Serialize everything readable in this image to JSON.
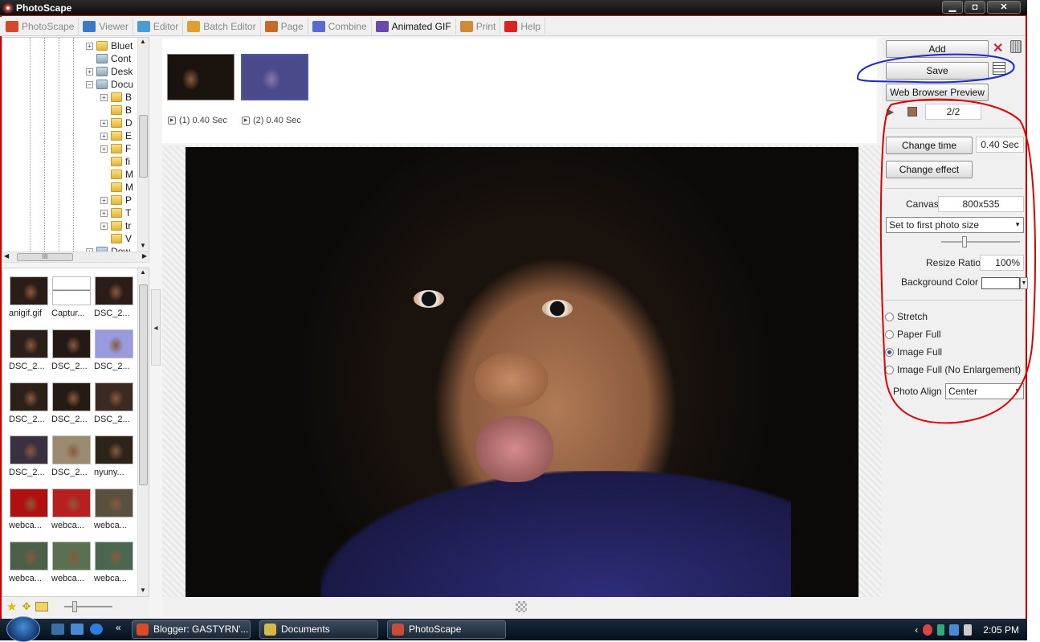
{
  "window": {
    "title": "PhotoScape",
    "minimize": "▁",
    "maximize": "◘",
    "close": "✕"
  },
  "tabs": [
    {
      "label": "PhotoScape",
      "color": "#d24a2a",
      "active": false
    },
    {
      "label": "Viewer",
      "color": "#3a7ac4",
      "active": false
    },
    {
      "label": "Editor",
      "color": "#4a9bd6",
      "active": false
    },
    {
      "label": "Batch Editor",
      "color": "#e0a030",
      "active": false
    },
    {
      "label": "Page",
      "color": "#c66a2a",
      "active": false
    },
    {
      "label": "Combine",
      "color": "#5a6ad0",
      "active": false
    },
    {
      "label": "Animated GIF",
      "color": "#6a4aa8",
      "active": true
    },
    {
      "label": "Print",
      "color": "#d08a3a",
      "active": false
    },
    {
      "label": "Help",
      "color": "#d22",
      "active": false
    }
  ],
  "tree": {
    "items": [
      {
        "label": "Bluet",
        "exp": "+",
        "type": "folder"
      },
      {
        "label": "Cont",
        "exp": "",
        "type": "blue"
      },
      {
        "label": "Desk",
        "exp": "+",
        "type": "blue"
      },
      {
        "label": "Docu",
        "exp": "−",
        "type": "blue"
      },
      {
        "label": "B",
        "exp": "+",
        "type": "folder"
      },
      {
        "label": "B",
        "exp": "",
        "type": "folder"
      },
      {
        "label": "D",
        "exp": "+",
        "type": "folder"
      },
      {
        "label": "E",
        "exp": "+",
        "type": "folder"
      },
      {
        "label": "F",
        "exp": "+",
        "type": "folder"
      },
      {
        "label": "fi",
        "exp": "",
        "type": "folder"
      },
      {
        "label": "M",
        "exp": "",
        "type": "folder"
      },
      {
        "label": "M",
        "exp": "",
        "type": "folder"
      },
      {
        "label": "P",
        "exp": "+",
        "type": "folder"
      },
      {
        "label": "T",
        "exp": "+",
        "type": "folder"
      },
      {
        "label": "tr",
        "exp": "+",
        "type": "folder"
      },
      {
        "label": "V",
        "exp": "",
        "type": "folder"
      },
      {
        "label": "Dow",
        "exp": "+",
        "type": "blue"
      }
    ],
    "hscroll_label": "III"
  },
  "thumbnails": [
    {
      "label": "anigif.gif",
      "tone": "#2a1d18"
    },
    {
      "label": "Captur...",
      "tone": "#f4f4f4"
    },
    {
      "label": "DSC_2...",
      "tone": "#2a1d18"
    },
    {
      "label": "DSC_2...",
      "tone": "#2b1f1a"
    },
    {
      "label": "DSC_2...",
      "tone": "#241914"
    },
    {
      "label": "DSC_2...",
      "tone": "#9a9ae0"
    },
    {
      "label": "DSC_2...",
      "tone": "#2c2018"
    },
    {
      "label": "DSC_2...",
      "tone": "#261a14"
    },
    {
      "label": "DSC_2...",
      "tone": "#3a2a22"
    },
    {
      "label": "DSC_2...",
      "tone": "#3a3040"
    },
    {
      "label": "DSC_2...",
      "tone": "#9a8a70"
    },
    {
      "label": "nyuny...",
      "tone": "#2c2418"
    },
    {
      "label": "webca...",
      "tone": "#b01010"
    },
    {
      "label": "webca...",
      "tone": "#b82020"
    },
    {
      "label": "webca...",
      "tone": "#5a5040"
    },
    {
      "label": "webca...",
      "tone": "#4a6048"
    },
    {
      "label": "webca...",
      "tone": "#5a7050"
    },
    {
      "label": "webca...",
      "tone": "#4a6850"
    }
  ],
  "frames": [
    {
      "label": "(1) 0.40 Sec",
      "selected": false
    },
    {
      "label": "(2) 0.40 Sec",
      "selected": true
    }
  ],
  "right_panel": {
    "add": "Add",
    "save": "Save",
    "web_preview": "Web Browser Preview",
    "frame_counter": "2/2",
    "change_time": "Change time",
    "time_value": "0.40 Sec",
    "change_effect": "Change effect",
    "canvas_label": "Canvas",
    "canvas_value": "800x535",
    "size_mode": "Set to first photo size",
    "resize_ratio_label": "Resize Ratio",
    "resize_ratio_value": "100%",
    "resize_ratio_level": 0.3,
    "bg_color_label": "Background Color",
    "bg_color": "#ffffff",
    "fit_options": [
      {
        "label": "Stretch",
        "selected": false
      },
      {
        "label": "Paper Full",
        "selected": false
      },
      {
        "label": "Image Full",
        "selected": true
      },
      {
        "label": "Image Full (No Enlargement)",
        "selected": false
      }
    ],
    "photo_align_label": "Photo Align",
    "photo_align_value": "Center"
  },
  "taskbar": {
    "tasks": [
      {
        "label": "Blogger: GASTYRN'...",
        "color": "#dd4a2a"
      },
      {
        "label": "Documents",
        "color": "#d8b848"
      },
      {
        "label": "PhotoScape",
        "color": "#c84a3a"
      }
    ],
    "expand": "«",
    "tray_arrow": "‹",
    "clock": "2:05 PM"
  },
  "colors": {
    "annotation_red": "#e00000",
    "annotation_blue": "#1a2ad0",
    "accent": "#2c4fa5"
  }
}
